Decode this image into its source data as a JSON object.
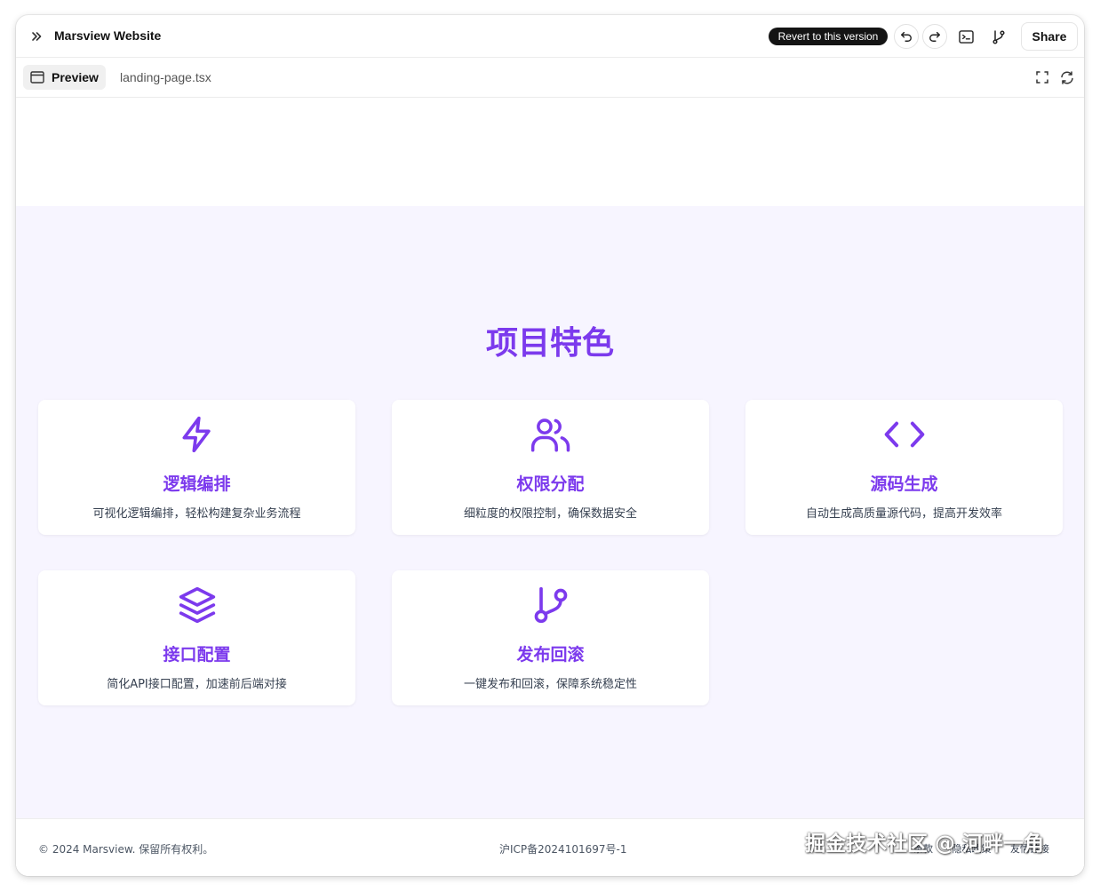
{
  "header": {
    "title": "Marsview Website",
    "revert_label": "Revert to this version",
    "share_label": "Share",
    "icons": [
      "expand-icon",
      "undo-icon",
      "redo-icon",
      "terminal-icon",
      "branch-icon"
    ]
  },
  "tabs": {
    "preview_label": "Preview",
    "file_label": "landing-page.tsx",
    "icons": [
      "browser-icon",
      "fullscreen-icon",
      "refresh-icon"
    ]
  },
  "features": {
    "title": "项目特色",
    "accent_color": "#7c3aed",
    "background_color": "#f7f5ff",
    "cards": [
      {
        "icon": "lightning-icon",
        "title": "逻辑编排",
        "desc": "可视化逻辑编排，轻松构建复杂业务流程"
      },
      {
        "icon": "users-icon",
        "title": "权限分配",
        "desc": "细粒度的权限控制，确保数据安全"
      },
      {
        "icon": "code-icon",
        "title": "源码生成",
        "desc": "自动生成高质量源代码，提高开发效率"
      },
      {
        "icon": "layers-icon",
        "title": "接口配置",
        "desc": "简化API接口配置，加速前后端对接"
      },
      {
        "icon": "git-branch-icon",
        "title": "发布回滚",
        "desc": "一键发布和回滚，保障系统稳定性"
      }
    ]
  },
  "footer": {
    "copyright": "© 2024 Marsview. 保留所有权利。",
    "icp": "沪ICP备2024101697号-1",
    "links": [
      "条款",
      "隐私政策",
      "友情链接"
    ]
  },
  "watermark": "掘金技术社区 @ 河畔一角"
}
